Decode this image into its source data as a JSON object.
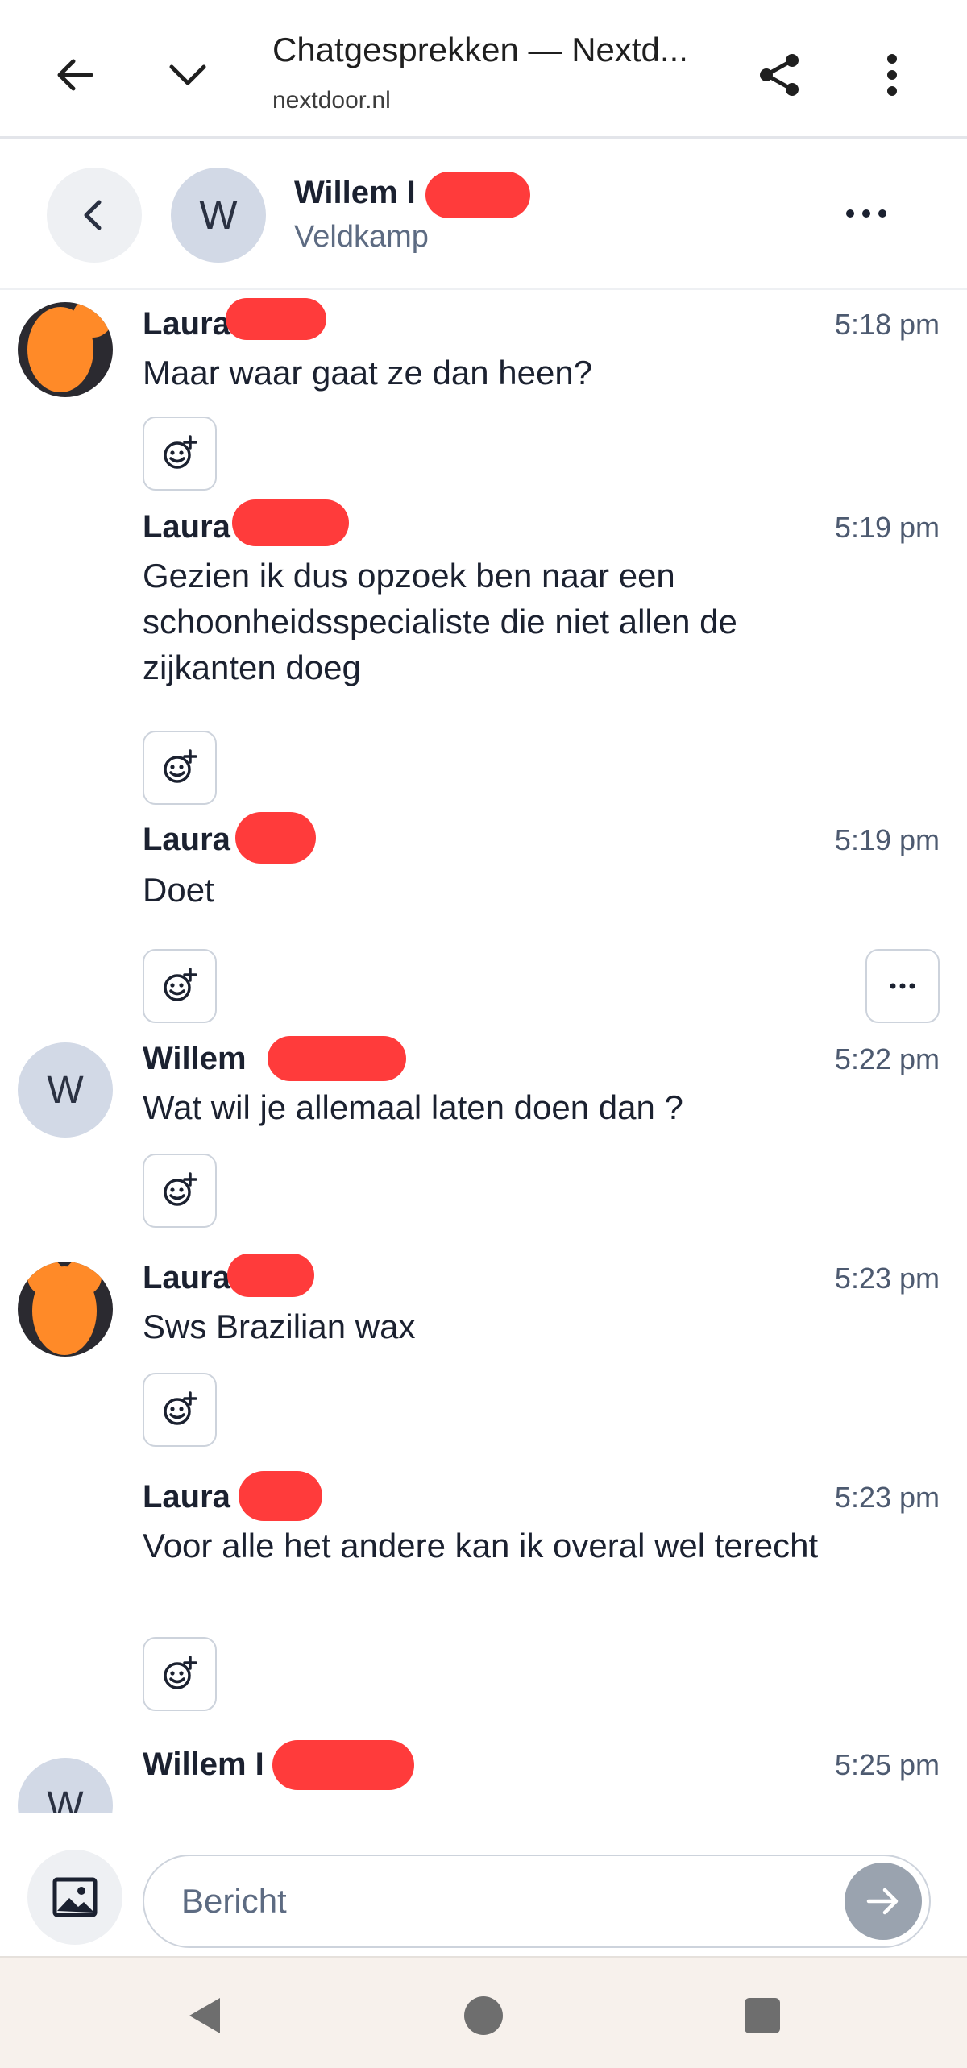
{
  "browser": {
    "title": "Chatgesprekken — Nextd...",
    "url": "nextdoor.nl"
  },
  "conversation": {
    "name": "Willem I",
    "subtitle": "Veldkamp",
    "avatar_initial": "W"
  },
  "messages": [
    {
      "sender": "Laura",
      "time": "5:18 pm",
      "text": "Maar waar gaat ze dan heen?"
    },
    {
      "sender": "Laura",
      "time": "5:19 pm",
      "text": "Gezien ik dus opzoek ben naar een schoonheidsspecialiste die niet allen de zijkanten doeg"
    },
    {
      "sender": "Laura",
      "time": "5:19 pm",
      "text": "Doet"
    },
    {
      "sender": "Willem",
      "time": "5:22 pm",
      "text": "Wat wil je allemaal laten doen dan ?",
      "avatar_initial": "W"
    },
    {
      "sender": "Laura",
      "time": "5:23 pm",
      "text": "Sws Brazilian wax"
    },
    {
      "sender": "Laura",
      "time": "5:23 pm",
      "text": "Voor alle het andere kan ik overal wel terecht"
    },
    {
      "sender": "Willem I",
      "time": "5:25 pm",
      "text": "",
      "avatar_initial": "W"
    }
  ],
  "composer": {
    "placeholder": "Bericht"
  },
  "colors": {
    "redaction": "#ff3b3b",
    "avatar_bg": "#d2d9e6",
    "blur_orange": "#ff8a28",
    "send_button": "#9aa3af"
  },
  "icons": [
    "back-arrow-icon",
    "chevron-down-icon",
    "share-icon",
    "kebab-menu-icon",
    "chevron-left-icon",
    "more-horizontal-icon",
    "add-reaction-icon",
    "image-icon",
    "send-arrow-icon",
    "nav-back-icon",
    "nav-home-icon",
    "nav-recents-icon"
  ]
}
